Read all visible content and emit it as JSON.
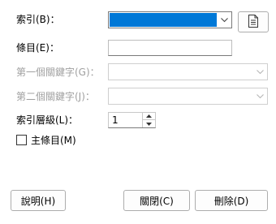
{
  "form": {
    "index_label": "索引(B)：",
    "entry_label": "條目(E)：",
    "entry_value": "",
    "key1_label": "第一個關鍵字(G)：",
    "key2_label": "第二個關鍵字(J)：",
    "level_label": "索引層級(L)：",
    "level_value": "1",
    "main_entry_label": "主條目(M)"
  },
  "buttons": {
    "help": "說明(H)",
    "close": "關閉(C)",
    "delete": "刪除(D)"
  },
  "colors": {
    "selection": "#0078d7"
  },
  "icons": {
    "index_dropdown": "chevron-down-icon",
    "new_index": "document-list-icon"
  }
}
